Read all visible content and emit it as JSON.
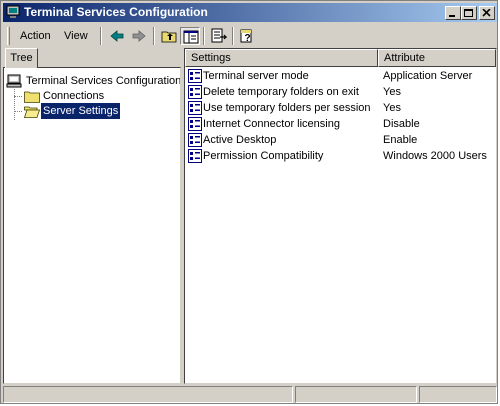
{
  "window": {
    "title": "Terminal Services Configuration",
    "icon": "terminal-services-icon"
  },
  "menu": {
    "items": [
      "Action",
      "View"
    ]
  },
  "toolbar": {
    "buttons": [
      "back-arrow-icon",
      "forward-arrow-icon",
      "up-folder-icon",
      "show-hide-tree-icon",
      "export-list-icon",
      "help-icon"
    ]
  },
  "tree": {
    "tab_label": "Tree",
    "root": "Terminal Services Configuration",
    "children": [
      "Connections",
      "Server Settings"
    ],
    "selected": "Server Settings"
  },
  "list": {
    "columns": [
      "Settings",
      "Attribute"
    ],
    "rows": [
      {
        "setting": "Terminal server mode",
        "attribute": "Application Server"
      },
      {
        "setting": "Delete temporary folders on exit",
        "attribute": "Yes"
      },
      {
        "setting": "Use temporary folders per session",
        "attribute": "Yes"
      },
      {
        "setting": "Internet Connector licensing",
        "attribute": "Disable"
      },
      {
        "setting": "Active Desktop",
        "attribute": "Enable"
      },
      {
        "setting": "Permission Compatibility",
        "attribute": "Windows 2000 Users"
      }
    ]
  },
  "colors": {
    "title_start": "#0a246a",
    "title_end": "#a6caf0",
    "face": "#d4d0c8",
    "selection": "#0a246a"
  }
}
